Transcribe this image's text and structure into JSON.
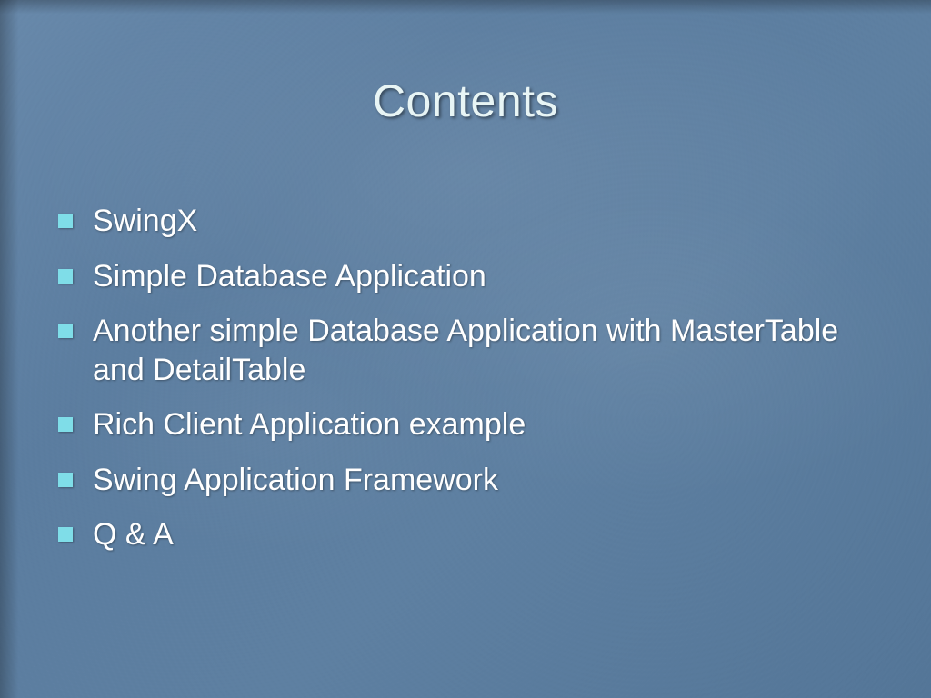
{
  "slide": {
    "title": "Contents",
    "bullets": [
      "SwingX",
      "Simple Database Application",
      "Another simple Database Application with MasterTable and DetailTable",
      "Rich Client Application example",
      "Swing Application Framework",
      "Q & A"
    ]
  },
  "colors": {
    "background": "#5e7fa1",
    "title": "#e8f5f5",
    "text": "#ffffff",
    "bullet": "#7fdde8"
  }
}
